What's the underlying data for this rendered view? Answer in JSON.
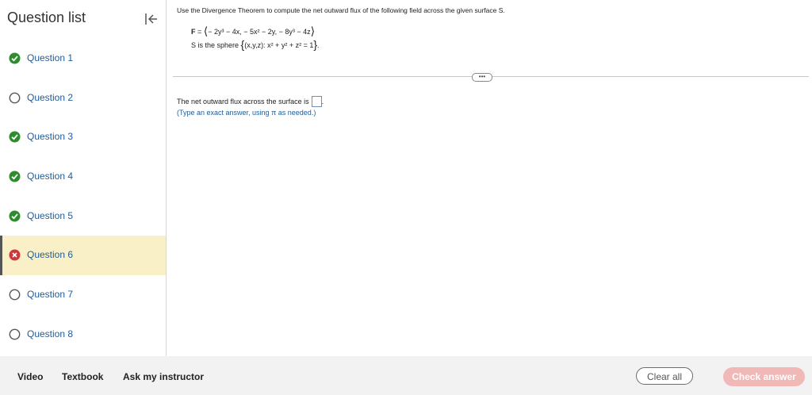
{
  "sidebar": {
    "title": "Question list",
    "items": [
      {
        "label": "Question 1",
        "status": "correct"
      },
      {
        "label": "Question 2",
        "status": "unanswered"
      },
      {
        "label": "Question 3",
        "status": "correct"
      },
      {
        "label": "Question 4",
        "status": "correct"
      },
      {
        "label": "Question 5",
        "status": "correct"
      },
      {
        "label": "Question 6",
        "status": "incorrect"
      },
      {
        "label": "Question 7",
        "status": "unanswered"
      },
      {
        "label": "Question 8",
        "status": "unanswered"
      }
    ]
  },
  "question": {
    "instruction": "Use the Divergence Theorem to compute the net outward flux of the following field across the given surface S.",
    "field_label": "F",
    "field_eq": " = ",
    "field_body": "− 2y³ − 4x, − 5x² − 2y, − 8y³ − 4z",
    "surface_prefix": "S is the sphere ",
    "surface_body": "(x,y,z): x² + y² + z² = 1",
    "surface_suffix": ".",
    "answer_prefix": "The net outward flux across the surface is",
    "answer_suffix": ".",
    "hint": "(Type an exact answer, using π as needed.)",
    "more_label": "•••"
  },
  "footer": {
    "video": "Video",
    "textbook": "Textbook",
    "ask": "Ask my instructor",
    "clear": "Clear all",
    "check": "Check answer"
  },
  "colors": {
    "correct": "#2e8b2e",
    "incorrect": "#d0363d",
    "link": "#1f5c99",
    "active_bg": "#faf0c8",
    "check_button": "#f1b8b8"
  }
}
